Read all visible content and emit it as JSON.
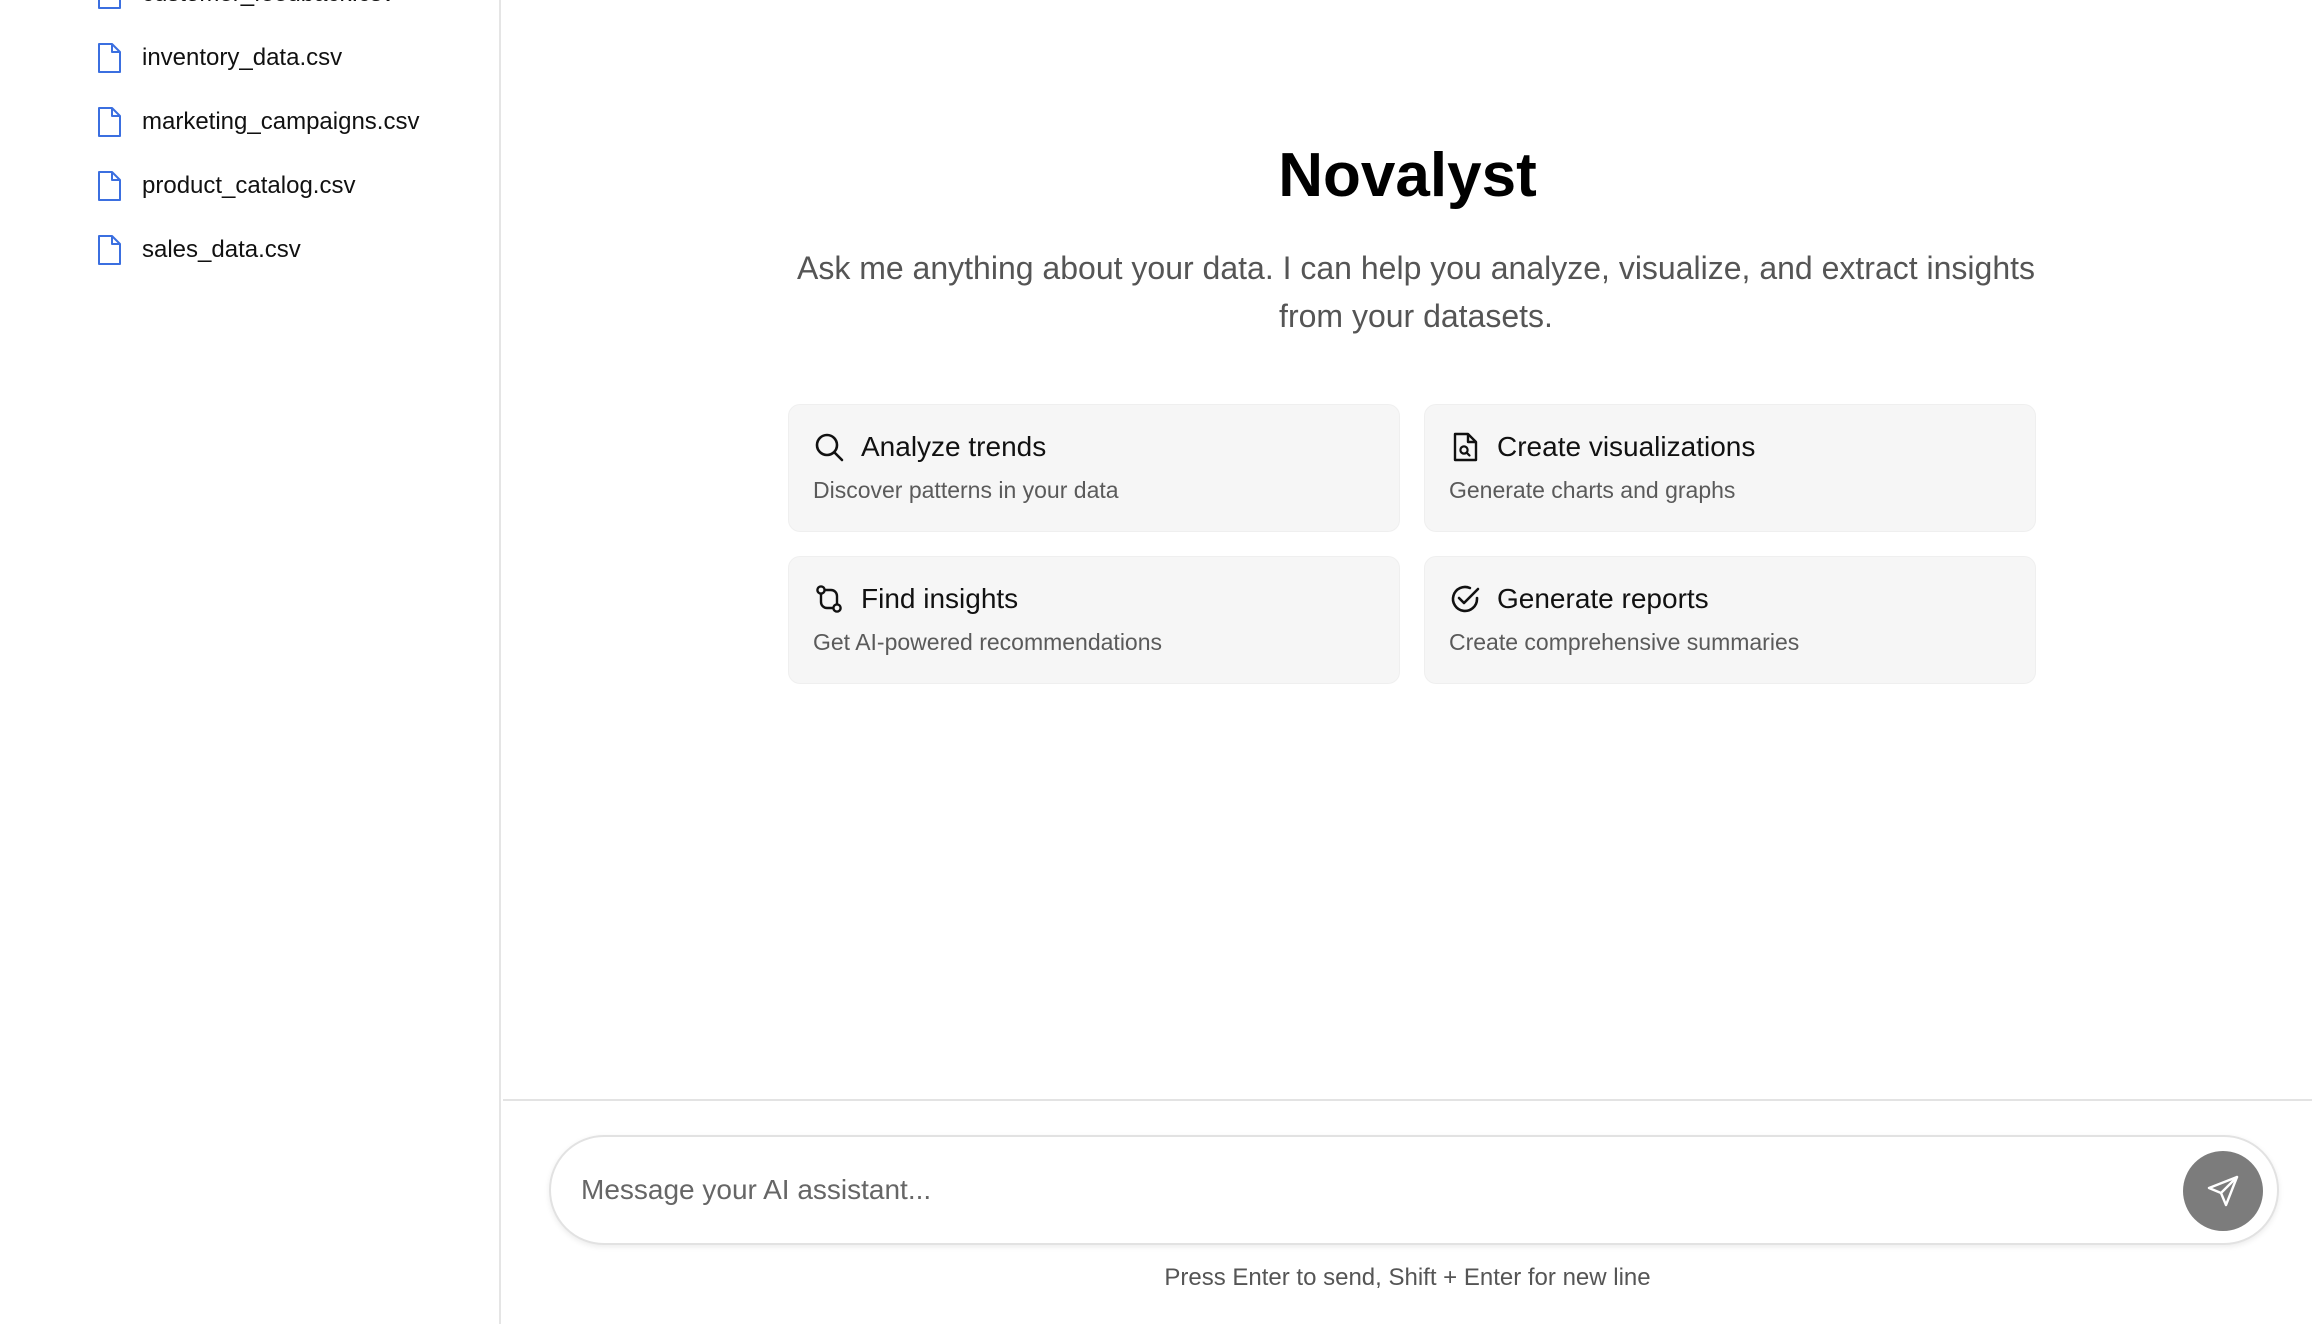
{
  "sidebar": {
    "files": [
      {
        "name": "customer_feedback.csv",
        "icon": "file-icon"
      },
      {
        "name": "inventory_data.csv",
        "icon": "file-icon"
      },
      {
        "name": "marketing_campaigns.csv",
        "icon": "file-icon"
      },
      {
        "name": "product_catalog.csv",
        "icon": "file-icon"
      },
      {
        "name": "sales_data.csv",
        "icon": "file-icon"
      }
    ],
    "icon_color": "#3b6fe0"
  },
  "welcome": {
    "title": "Novalyst",
    "subtitle": "Ask me anything about your data. I can help you analyze, visualize, and extract insights from your datasets.",
    "cards": [
      {
        "title": "Analyze trends",
        "description": "Discover patterns in your data",
        "icon": "search-icon"
      },
      {
        "title": "Create visualizations",
        "description": "Generate charts and graphs",
        "icon": "file-search-icon"
      },
      {
        "title": "Find insights",
        "description": "Get AI-powered recommendations",
        "icon": "git-compare-icon"
      },
      {
        "title": "Generate reports",
        "description": "Create comprehensive summaries",
        "icon": "check-circle-icon"
      }
    ]
  },
  "composer": {
    "placeholder": "Message your AI assistant...",
    "value": "",
    "send_icon": "send-icon",
    "hint": "Press Enter to send, Shift + Enter for new line"
  },
  "colors": {
    "send_button": "#7c7c7c",
    "card_background": "#f6f6f6"
  }
}
